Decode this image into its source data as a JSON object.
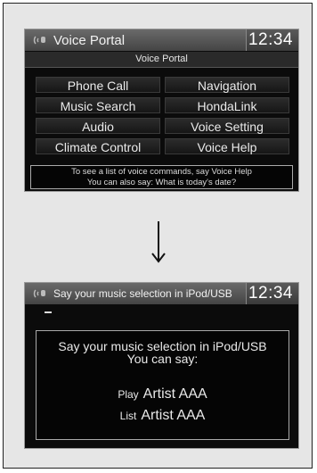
{
  "screen1": {
    "title": "Voice Portal",
    "clock": "12:34",
    "subheader": "Voice Portal",
    "buttons": [
      "Phone Call",
      "Navigation",
      "Music Search",
      "HondaLink",
      "Audio",
      "Voice Setting",
      "Climate Control",
      "Voice Help"
    ],
    "hint_line1": "To see a list of voice commands, say Voice Help",
    "hint_line2": "You can also say: What is today's date?"
  },
  "screen2": {
    "title": "Say your music selection in iPod/USB",
    "clock": "12:34",
    "message_line1": "Say your music selection in iPod/USB",
    "message_line2": "You can say:",
    "examples": [
      {
        "verb": "Play",
        "object": "Artist AAA"
      },
      {
        "verb": "List",
        "object": "Artist AAA"
      }
    ]
  },
  "icons": {
    "mic": "microphone-icon",
    "arrow": "arrow-down-icon"
  },
  "colors": {
    "screen_bg": "#0b0b0b",
    "page_bg": "#e6e6e6",
    "text": "#eaeaea"
  }
}
